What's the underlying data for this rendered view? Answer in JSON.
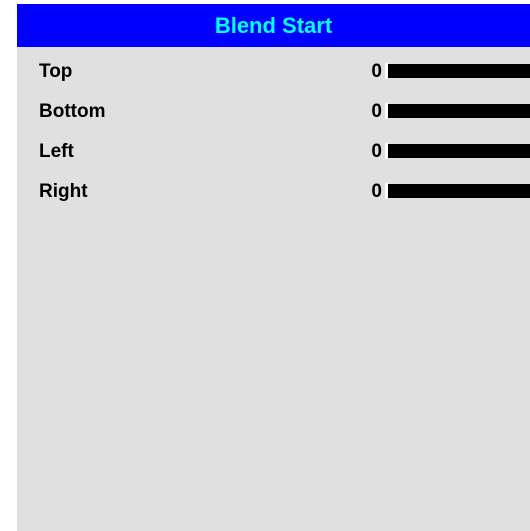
{
  "menu": {
    "title": "Blend Start",
    "items": [
      {
        "label": "Top",
        "value": "0"
      },
      {
        "label": "Bottom",
        "value": "0"
      },
      {
        "label": "Left",
        "value": "0"
      },
      {
        "label": "Right",
        "value": "0"
      }
    ]
  },
  "colors": {
    "title_background": "#0000ff",
    "title_text": "#00ffff",
    "panel_background": "#e0e0e0",
    "slider_fill": "#000000"
  }
}
